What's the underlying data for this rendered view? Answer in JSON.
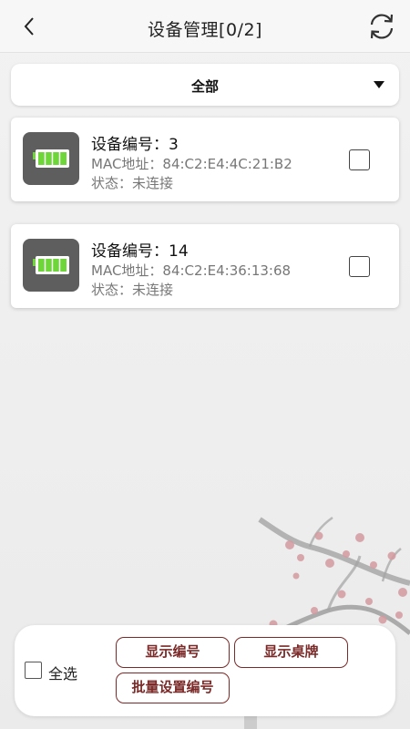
{
  "header": {
    "title": "设备管理[0/2]",
    "back_icon": "chevron-left-icon",
    "refresh_icon": "refresh-icon"
  },
  "filter": {
    "selected": "全部"
  },
  "devices": [
    {
      "name": "设备编号：3",
      "mac": "MAC地址：84:C2:E4:4C:21:B2",
      "state": "状态：未连接",
      "checked": false
    },
    {
      "name": "设备编号：14",
      "mac": "MAC地址：84:C2:E4:36:13:68",
      "state": "状态：未连接",
      "checked": false
    }
  ],
  "bottom": {
    "select_all": "全选",
    "show_number": "显示编号",
    "show_tablet": "显示桌牌",
    "batch_set_number": "批量设置编号"
  },
  "colors": {
    "accent": "#7a2a28",
    "battery_green": "#6fd63a",
    "icon_bg": "#5e5e5e"
  }
}
